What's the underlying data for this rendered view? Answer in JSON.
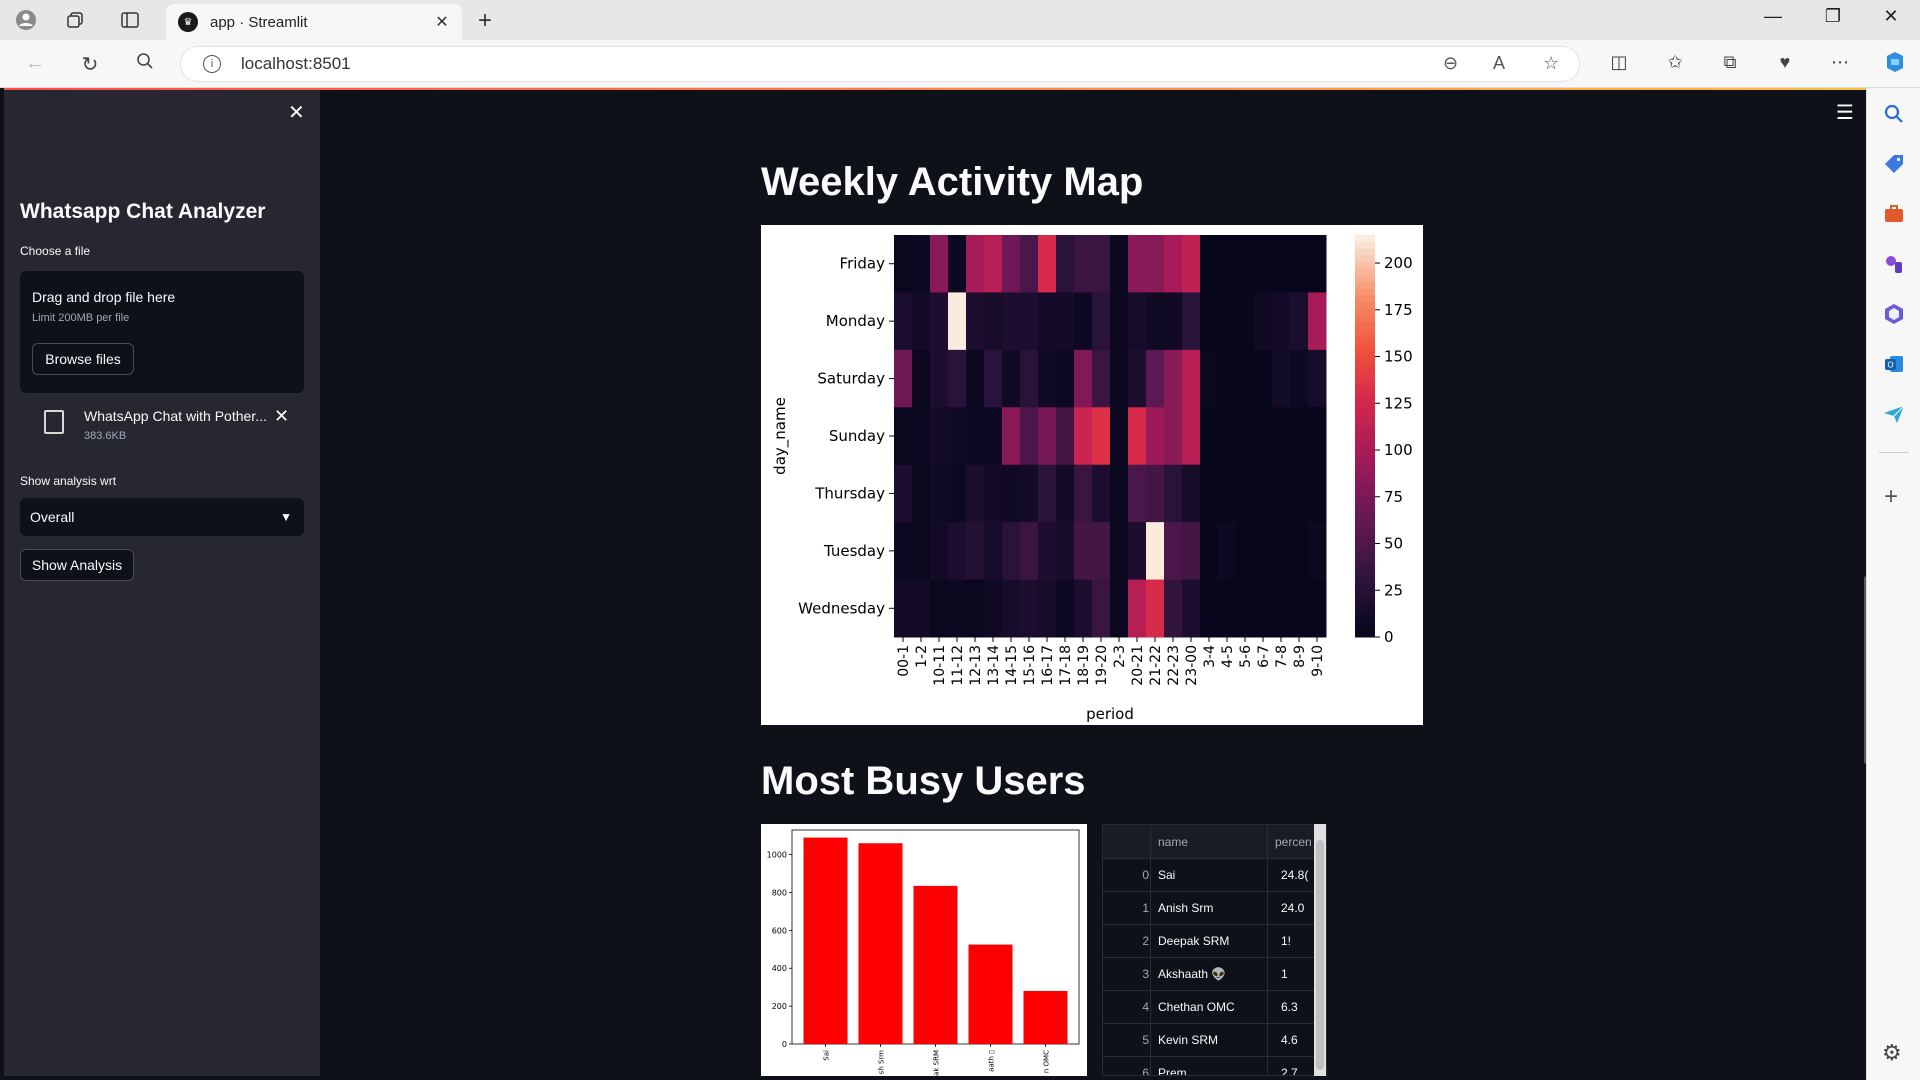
{
  "browser": {
    "tab_title": "app · Streamlit",
    "url": "localhost:8501"
  },
  "sidebar": {
    "title": "Whatsapp Chat Analyzer",
    "choose_label": "Choose a file",
    "dropzone_title": "Drag and drop file here",
    "dropzone_limit": "Limit 200MB per file",
    "browse_label": "Browse files",
    "file_name": "WhatsApp Chat with Pother...",
    "file_size": "383.6KB",
    "analysis_label": "Show analysis wrt",
    "analysis_value": "Overall",
    "show_button": "Show Analysis"
  },
  "main": {
    "heatmap_heading": "Weekly Activity Map",
    "busy_heading": "Most Busy Users"
  },
  "chart_data": [
    {
      "type": "heatmap",
      "ylabel": "day_name",
      "xlabel": "period",
      "rows": [
        "Friday",
        "Monday",
        "Saturday",
        "Sunday",
        "Thursday",
        "Tuesday",
        "Wednesday"
      ],
      "columns": [
        "00-1",
        "1-2",
        "10-11",
        "11-12",
        "12-13",
        "13-14",
        "14-15",
        "15-16",
        "16-17",
        "17-18",
        "18-19",
        "19-20",
        "2-3",
        "20-21",
        "21-22",
        "22-23",
        "23-00",
        "3-4",
        "4-5",
        "5-6",
        "6-7",
        "7-8",
        "8-9",
        "9-10"
      ],
      "colorbar_ticks": [
        0,
        25,
        50,
        75,
        100,
        125,
        150,
        175,
        200
      ],
      "values": [
        [
          5,
          8,
          85,
          8,
          100,
          110,
          70,
          50,
          130,
          30,
          40,
          40,
          8,
          85,
          85,
          100,
          115,
          3,
          3,
          3,
          3,
          3,
          3,
          3
        ],
        [
          18,
          12,
          20,
          215,
          20,
          15,
          20,
          20,
          12,
          12,
          8,
          30,
          5,
          15,
          10,
          10,
          30,
          3,
          3,
          3,
          10,
          12,
          18,
          100
        ],
        [
          70,
          5,
          20,
          30,
          8,
          30,
          10,
          30,
          10,
          8,
          80,
          40,
          8,
          20,
          60,
          85,
          110,
          5,
          3,
          3,
          3,
          12,
          8,
          15
        ],
        [
          5,
          8,
          12,
          10,
          8,
          8,
          85,
          50,
          75,
          45,
          120,
          135,
          5,
          130,
          95,
          85,
          110,
          3,
          3,
          3,
          3,
          3,
          3,
          3
        ],
        [
          20,
          5,
          10,
          8,
          20,
          12,
          10,
          12,
          30,
          12,
          40,
          20,
          5,
          50,
          45,
          30,
          15,
          3,
          3,
          3,
          3,
          3,
          3,
          3
        ],
        [
          8,
          5,
          12,
          20,
          25,
          15,
          30,
          40,
          20,
          15,
          45,
          45,
          5,
          20,
          215,
          50,
          45,
          3,
          8,
          3,
          3,
          3,
          3,
          8
        ],
        [
          12,
          12,
          5,
          8,
          5,
          10,
          15,
          20,
          15,
          8,
          20,
          40,
          5,
          110,
          130,
          35,
          20,
          3,
          3,
          3,
          3,
          3,
          3,
          3
        ]
      ]
    },
    {
      "type": "bar",
      "categories": [
        "Sai",
        "Anish Srm",
        "Deepak SRM",
        "Akshaath 👽",
        "Chethan OMC"
      ],
      "category_labels_visible": [
        "Sai",
        "sh Srm",
        "ak SRM",
        "aath ▯",
        "n OMC"
      ],
      "values": [
        1090,
        1060,
        835,
        525,
        280
      ],
      "ylim": [
        0,
        1130
      ],
      "yticks": [
        0,
        200,
        400,
        600,
        800,
        1000
      ],
      "bar_color": "#ff0000"
    }
  ],
  "dataframe": {
    "headers": [
      "name",
      "percen"
    ],
    "rows": [
      {
        "idx": "0",
        "name": "Sai",
        "pct": "24.8("
      },
      {
        "idx": "1",
        "name": "Anish Srm",
        "pct": "24.0"
      },
      {
        "idx": "2",
        "name": "Deepak SRM",
        "pct": "1!"
      },
      {
        "idx": "3",
        "name": "Akshaath 👽",
        "pct": "1"
      },
      {
        "idx": "4",
        "name": "Chethan OMC",
        "pct": "6.3"
      },
      {
        "idx": "5",
        "name": "Kevin SRM",
        "pct": "4.6"
      },
      {
        "idx": "6",
        "name": "Prem",
        "pct": "2.7"
      }
    ]
  },
  "colors": {
    "app_bg": "#0e1117",
    "sidebar_bg": "#262730",
    "text": "#fafafa",
    "bar": "#ff0000"
  }
}
